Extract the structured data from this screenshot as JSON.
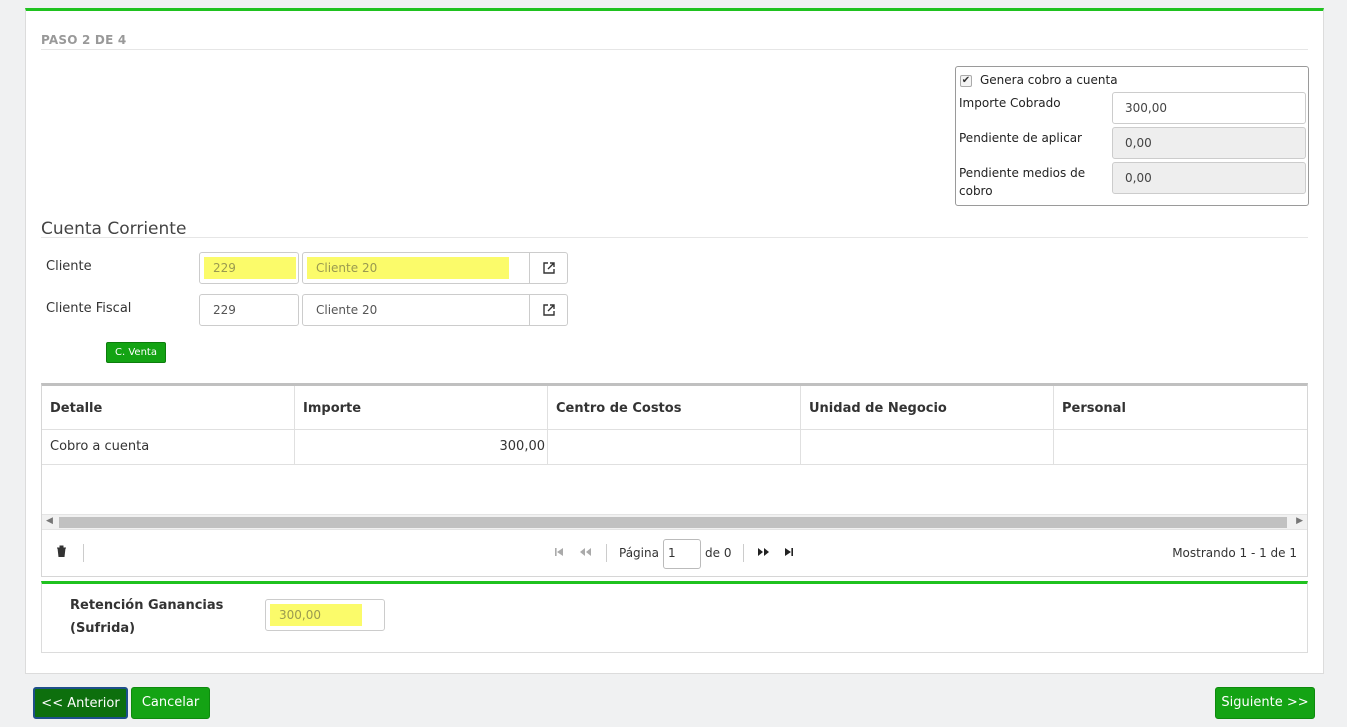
{
  "step": {
    "title": "PASO 2 DE 4"
  },
  "cobro": {
    "checkbox_label": "Genera cobro a cuenta",
    "checked": true,
    "importe_cobrado_label": "Importe Cobrado",
    "importe_cobrado_value": "300,00",
    "pendiente_aplicar_label": "Pendiente de aplicar",
    "pendiente_aplicar_value": "0,00",
    "pendiente_medios_label": "Pendiente medios de cobro",
    "pendiente_medios_value": "0,00"
  },
  "cuenta": {
    "title": "Cuenta Corriente",
    "cliente_label": "Cliente",
    "cliente_code": "229",
    "cliente_name": "Cliente 20",
    "cliente_fiscal_label": "Cliente Fiscal",
    "cliente_fiscal_code": "229",
    "cliente_fiscal_name": "Cliente 20",
    "venta_button": "C. Venta"
  },
  "grid": {
    "columns": [
      "Detalle",
      "Importe",
      "Centro de Costos",
      "Unidad de Negocio",
      "Personal"
    ],
    "rows": [
      [
        "Cobro a cuenta",
        "300,00",
        "",
        "",
        ""
      ]
    ],
    "pager": {
      "page_label": "Página",
      "page_value": "1",
      "of_label": "de 0",
      "showing": "Mostrando 1 - 1 de 1"
    }
  },
  "retencion": {
    "label": "Retención Ganancias (Sufrida)",
    "value": "300,00"
  },
  "footer": {
    "prev": "<< Anterior",
    "cancel": "Cancelar",
    "next": "Siguiente >>"
  },
  "colors": {
    "accent_green": "#1fc21f",
    "button_green": "#14a314",
    "highlight": "#fbfb6a"
  }
}
